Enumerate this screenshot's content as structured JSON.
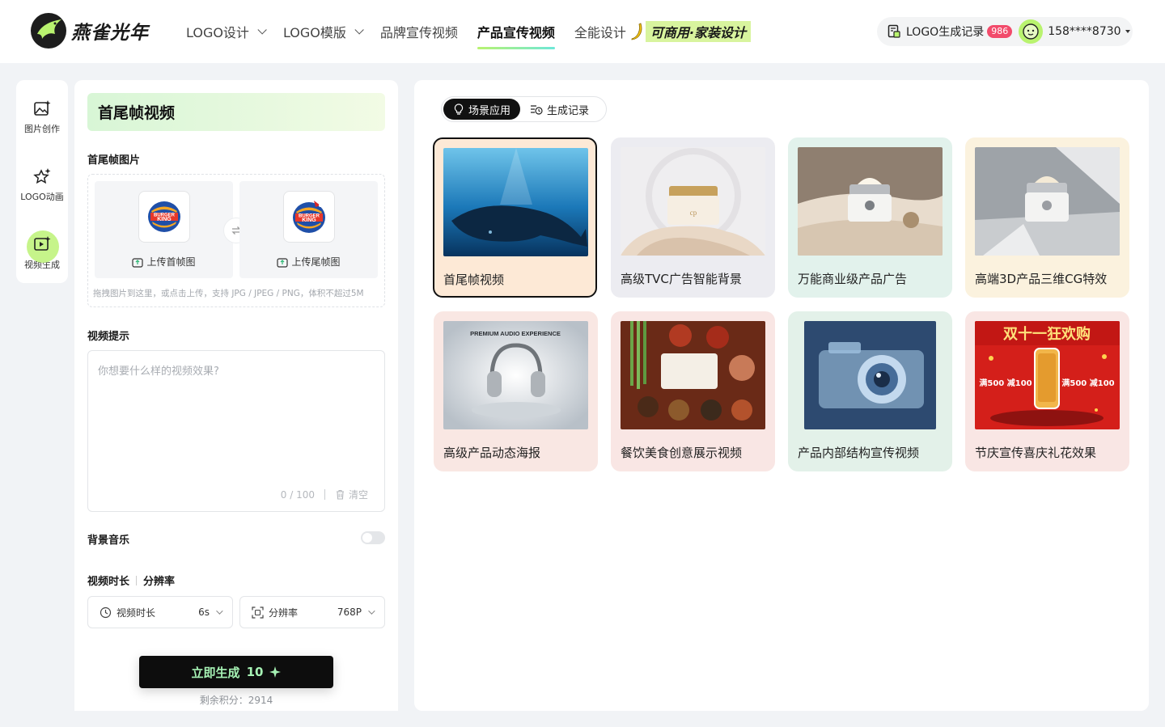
{
  "header": {
    "brand": "燕雀光年",
    "nav": [
      {
        "label": "LOGO设计",
        "has_dropdown": true
      },
      {
        "label": "LOGO模版",
        "has_dropdown": true
      },
      {
        "label": "品牌宣传视频",
        "has_dropdown": false
      },
      {
        "label": "产品宣传视频",
        "has_dropdown": false,
        "active": true
      },
      {
        "label": "全能设计",
        "has_dropdown": false
      }
    ],
    "promo": "可商用·家装设计",
    "record_label": "LOGO生成记录",
    "record_count": "986",
    "user_phone": "158****8730"
  },
  "rail": {
    "items": [
      {
        "label": "图片创作",
        "icon": "image-sparkle-icon"
      },
      {
        "label": "LOGO动画",
        "icon": "logo-animation-icon"
      },
      {
        "label": "视频生成",
        "icon": "video-generate-icon",
        "active": true
      }
    ]
  },
  "form": {
    "title": "首尾帧视频",
    "frames_label": "首尾帧图片",
    "upload_first": "上传首帧图",
    "upload_last": "上传尾帧图",
    "upload_hint": "拖拽图片到这里，或点击上传，支持 JPG / JPEG / PNG，体积不超过5M",
    "prompt_label": "视频提示",
    "prompt_placeholder": "你想要什么样的视频效果?",
    "prompt_value": "",
    "prompt_counter": "0 / 100",
    "clear_label": "清空",
    "music_label": "背景音乐",
    "music_on": false,
    "duration_section": "视频时长",
    "resolution_section": "分辨率",
    "duration_select_label": "视频时长",
    "duration_value": "6s",
    "resolution_select_label": "分辨率",
    "resolution_value": "768P",
    "generate_label": "立即生成",
    "generate_cost": "10",
    "credits_text": "剩余积分：2914"
  },
  "main": {
    "tabs": [
      {
        "label": "场景应用",
        "active": true
      },
      {
        "label": "生成记录",
        "active": false
      }
    ],
    "cards": [
      {
        "caption": "首尾帧视频",
        "bg": "#fde9d6",
        "selected": true,
        "scene": "whale"
      },
      {
        "caption": "高级TVC广告智能背景",
        "bg": "#ececf1",
        "scene": "cream-jar"
      },
      {
        "caption": "万能商业级产品广告",
        "bg": "#e2f2ec",
        "scene": "cream-sand"
      },
      {
        "caption": "高端3D产品三维CG特效",
        "bg": "#fbf2de",
        "scene": "cream-light"
      },
      {
        "caption": "高级产品动态海报",
        "bg": "#f9e7e3",
        "scene": "headphones",
        "poster_text": "PREMIUM AUDIO EXPERIENCE"
      },
      {
        "caption": "餐饮美食创意展示视频",
        "bg": "#f9e6e4",
        "scene": "food"
      },
      {
        "caption": "产品内部结构宣传视频",
        "bg": "#e3f1e9",
        "scene": "camera"
      },
      {
        "caption": "节庆宣传喜庆礼花效果",
        "bg": "#f9e6e4",
        "scene": "festival",
        "poster_title": "双十一狂欢购",
        "poster_left": "满500 减100",
        "poster_right": "满500 减100"
      }
    ]
  },
  "colors": {
    "accent_green": "#b9f36f",
    "accent_teal": "#6ee7d9",
    "badge_red": "#f24b6b",
    "button_black": "#0d0d0d"
  }
}
